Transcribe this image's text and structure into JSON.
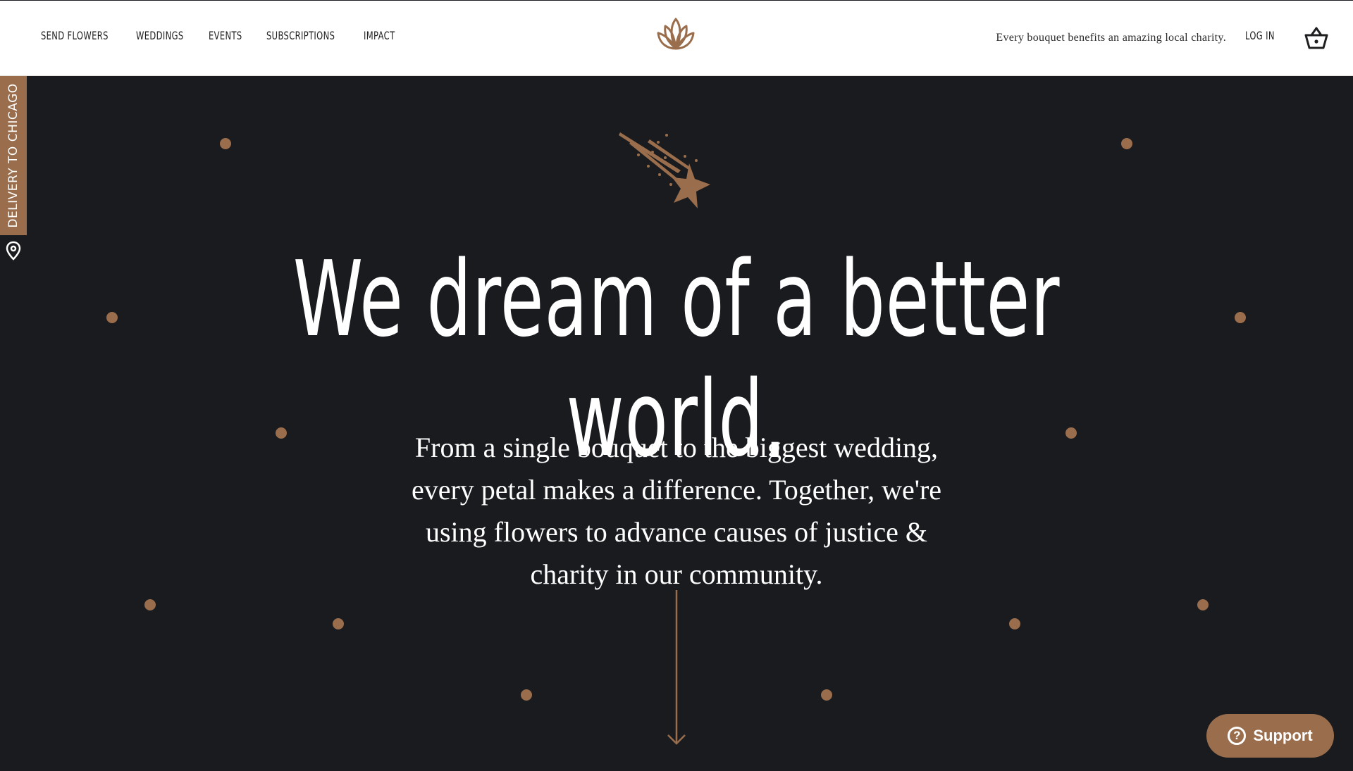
{
  "colors": {
    "accent": "#9a6e4c",
    "background": "#1a1b1f",
    "header_bg": "#ffffff"
  },
  "header": {
    "nav": [
      {
        "label": "SEND FLOWERS"
      },
      {
        "label": "WEDDINGS"
      },
      {
        "label": "EVENTS"
      },
      {
        "label": "SUBSCRIPTIONS"
      },
      {
        "label": "IMPACT"
      }
    ],
    "logo_icon": "lotus-icon",
    "tagline": "Every bouquet benefits an amazing local charity.",
    "login_label": "LOG IN",
    "cart_icon": "basket-icon"
  },
  "side_tab": {
    "label": "DELIVERY TO CHICAGO",
    "icon": "location-pin-icon"
  },
  "hero": {
    "decoration_icon": "shooting-star-icon",
    "title": "We dream of a better world.",
    "lead": "From a single bouquet to the biggest wedding, every petal makes a difference. Together, we're using flowers to advance causes of justice & charity in our community.",
    "scroll_icon": "arrow-down-icon"
  },
  "support": {
    "label": "Support",
    "icon": "question-icon",
    "icon_glyph": "?"
  }
}
